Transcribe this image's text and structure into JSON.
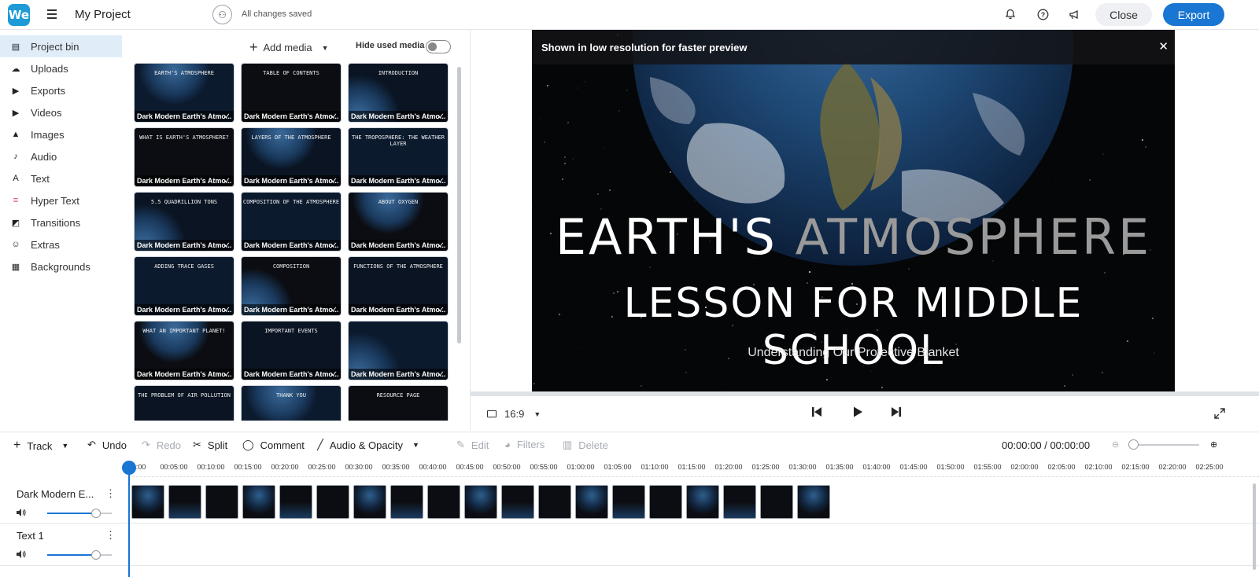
{
  "topbar": {
    "logo": "We",
    "project_title": "My Project",
    "save_status": "All changes saved",
    "close_label": "Close",
    "export_label": "Export"
  },
  "sidebar": {
    "items": [
      {
        "label": "Project bin",
        "icon": "▤"
      },
      {
        "label": "Uploads",
        "icon": "☁"
      },
      {
        "label": "Exports",
        "icon": "▶"
      },
      {
        "label": "Videos",
        "icon": "▶"
      },
      {
        "label": "Images",
        "icon": "▲"
      },
      {
        "label": "Audio",
        "icon": "♪"
      },
      {
        "label": "Text",
        "icon": "A"
      },
      {
        "label": "Hyper Text",
        "icon": "≡"
      },
      {
        "label": "Transitions",
        "icon": "◩"
      },
      {
        "label": "Extras",
        "icon": "☺"
      },
      {
        "label": "Backgrounds",
        "icon": "▦"
      }
    ]
  },
  "bin": {
    "add_media": "Add media",
    "hide_used": "Hide used media",
    "thumb_caption": "Dark Modern Earth's Atmo...",
    "thumb_titles": [
      "EARTH'S ATMOSPHERE",
      "TABLE OF CONTENTS",
      "INTRODUCTION",
      "WHAT IS EARTH'S ATMOSPHERE?",
      "LAYERS OF THE ATMOSPHERE",
      "THE TROPOSPHERE: THE WEATHER LAYER",
      "5.5 QUADRILLION TONS",
      "COMPOSITION OF THE ATMOSPHERE",
      "ABOUT OXYGEN",
      "ADDING TRACE GASES",
      "COMPOSITION",
      "FUNCTIONS OF THE ATMOSPHERE",
      "WHAT AN IMPORTANT PLANET!",
      "IMPORTANT EVENTS",
      "",
      "THE PROBLEM OF AIR POLLUTION",
      "THANK YOU",
      "RESOURCE PAGE"
    ]
  },
  "preview": {
    "notice": "Shown in low resolution for faster preview",
    "headline_line1_a": "EARTH'S ",
    "headline_line1_b": "ATMOSPHERE",
    "headline_line2": "LESSON FOR MIDDLE SCHOOL",
    "subtitle": "Understanding Our Protective Blanket",
    "aspect_ratio": "16:9"
  },
  "toolbar": {
    "track": "Track",
    "undo": "Undo",
    "redo": "Redo",
    "split": "Split",
    "comment": "Comment",
    "audio_opacity": "Audio & Opacity",
    "edit": "Edit",
    "filters": "Filters",
    "delete": "Delete",
    "time": "00:00:00 / 00:00:00"
  },
  "timeline": {
    "ticks": [
      "00:00",
      "00:05:00",
      "00:10:00",
      "00:15:00",
      "00:20:00",
      "00:25:00",
      "00:30:00",
      "00:35:00",
      "00:40:00",
      "00:45:00",
      "00:50:00",
      "00:55:00",
      "01:00:00",
      "01:05:00",
      "01:10:00",
      "01:15:00",
      "01:20:00",
      "01:25:00",
      "01:30:00",
      "01:35:00",
      "01:40:00",
      "01:45:00",
      "01:50:00",
      "01:55:00",
      "02:00:00",
      "02:05:00",
      "02:10:00",
      "02:15:00",
      "02:20:00",
      "02:25:00"
    ],
    "tracks": [
      {
        "name": "Dark Modern E...",
        "volume": 0.75
      },
      {
        "name": "Text 1",
        "volume": 0.75
      }
    ],
    "clip_count": 19
  },
  "colors": {
    "accent": "#1976d2",
    "logo": "#1e9bd7"
  }
}
